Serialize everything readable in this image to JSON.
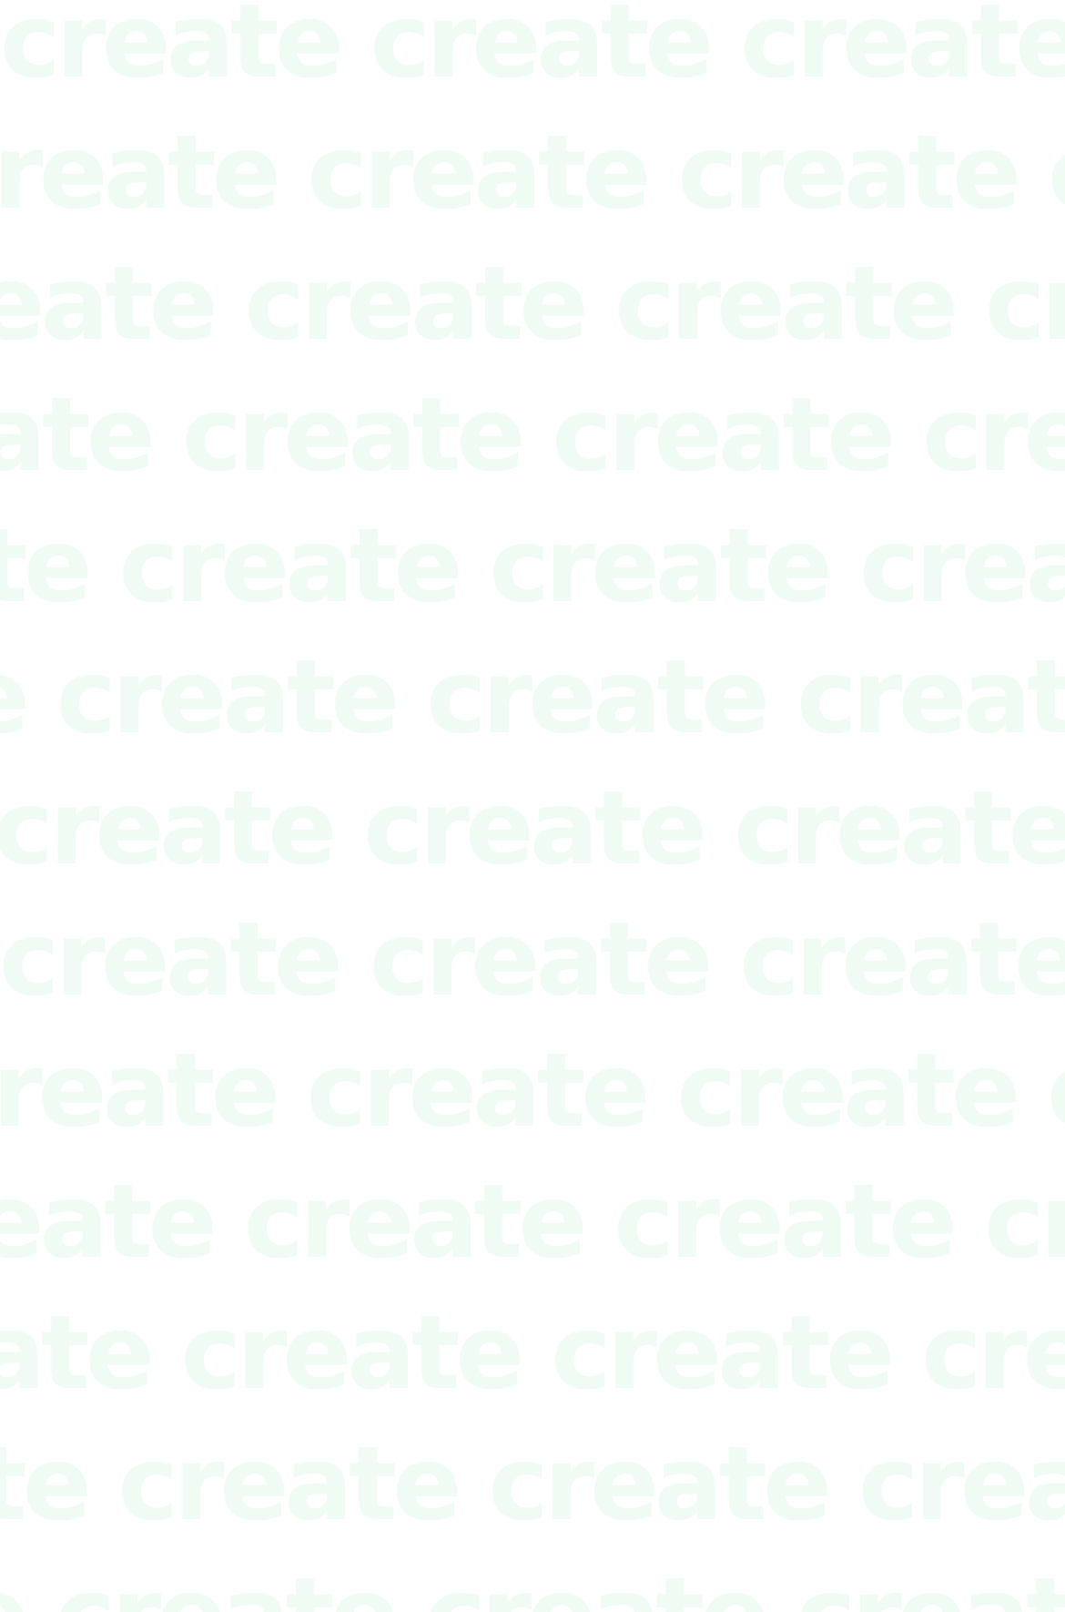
{
  "background": {
    "color": "#ffffff",
    "text_color": "#f0fbf3",
    "word": "create"
  }
}
